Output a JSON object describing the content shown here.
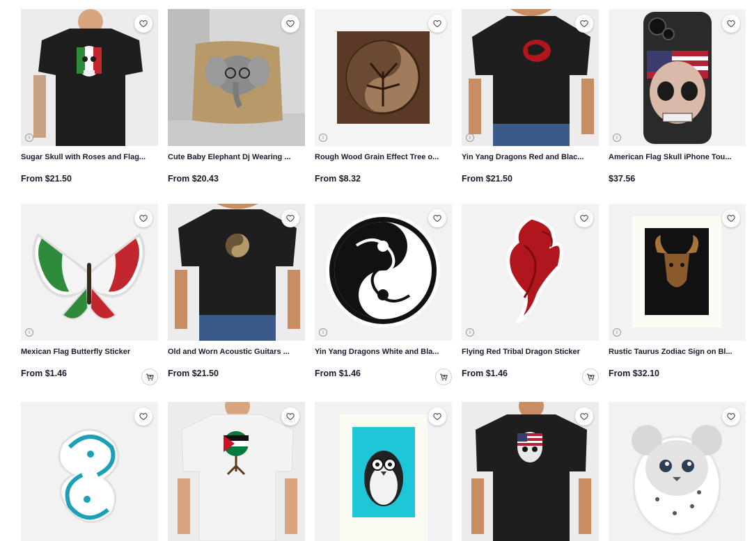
{
  "products": [
    {
      "title": "Sugar Skull with Roses and Flag...",
      "price": "From $21.50",
      "favorite_icon": "heart-icon",
      "info_icon": "info-icon",
      "type": "tshirt",
      "shirt_color": "#1e1e1e",
      "art": "mexico-skull"
    },
    {
      "title": "Cute Baby Elephant Dj Wearing ...",
      "price": "From $20.43",
      "favorite_icon": "heart-icon",
      "type": "pillow",
      "art": "elephant"
    },
    {
      "title": "Rough Wood Grain Effect Tree o...",
      "price": "From $8.32",
      "favorite_icon": "heart-icon",
      "info_icon": "info-icon",
      "type": "wood-print",
      "art": "tree-yinyang"
    },
    {
      "title": "Yin Yang Dragons Red and Blac...",
      "price": "From $21.50",
      "favorite_icon": "heart-icon",
      "info_icon": "info-icon",
      "type": "tshirt",
      "shirt_color": "#1e1e1e",
      "art": "red-dragons"
    },
    {
      "title": "American Flag Skull iPhone Tou...",
      "price": "$37.56",
      "favorite_icon": "heart-icon",
      "info_icon": "info-icon",
      "type": "phone-case",
      "art": "usa-skull"
    },
    {
      "title": "Mexican Flag Butterfly Sticker",
      "price": "From $1.46",
      "favorite_icon": "heart-icon",
      "info_icon": "info-icon",
      "cart_icon": "add-to-cart-icon",
      "type": "sticker",
      "art": "butterfly"
    },
    {
      "title": "Old and Worn Acoustic Guitars ...",
      "price": "From $21.50",
      "favorite_icon": "heart-icon",
      "type": "tshirt",
      "shirt_color": "#1e1e1e",
      "art": "guitar-yinyang"
    },
    {
      "title": "Yin Yang Dragons White and Bla...",
      "price": "From $1.46",
      "favorite_icon": "heart-icon",
      "info_icon": "info-icon",
      "cart_icon": "add-to-cart-icon",
      "type": "sticker",
      "art": "bw-dragons"
    },
    {
      "title": "Flying Red Tribal Dragon Sticker",
      "price": "From $1.46",
      "favorite_icon": "heart-icon",
      "info_icon": "info-icon",
      "cart_icon": "add-to-cart-icon",
      "type": "sticker",
      "art": "red-dragon"
    },
    {
      "title": "Rustic Taurus Zodiac Sign on Bl...",
      "price": "From $32.10",
      "favorite_icon": "heart-icon",
      "info_icon": "info-icon",
      "type": "framed-print",
      "art": "taurus"
    },
    {
      "title": "",
      "price": "",
      "favorite_icon": "heart-icon",
      "type": "sticker",
      "art": "blue-pisces"
    },
    {
      "title": "",
      "price": "",
      "favorite_icon": "heart-icon",
      "type": "tshirt",
      "shirt_color": "#e8e8e8",
      "art": "palestine-tree"
    },
    {
      "title": "",
      "price": "",
      "favorite_icon": "heart-icon",
      "type": "framed-print",
      "art": "penguin"
    },
    {
      "title": "",
      "price": "",
      "favorite_icon": "heart-icon",
      "type": "tshirt",
      "shirt_color": "#1e1e1e",
      "art": "usa-skull-small"
    },
    {
      "title": "",
      "price": "",
      "favorite_icon": "heart-icon",
      "type": "sticker",
      "art": "snow-leopard"
    }
  ]
}
